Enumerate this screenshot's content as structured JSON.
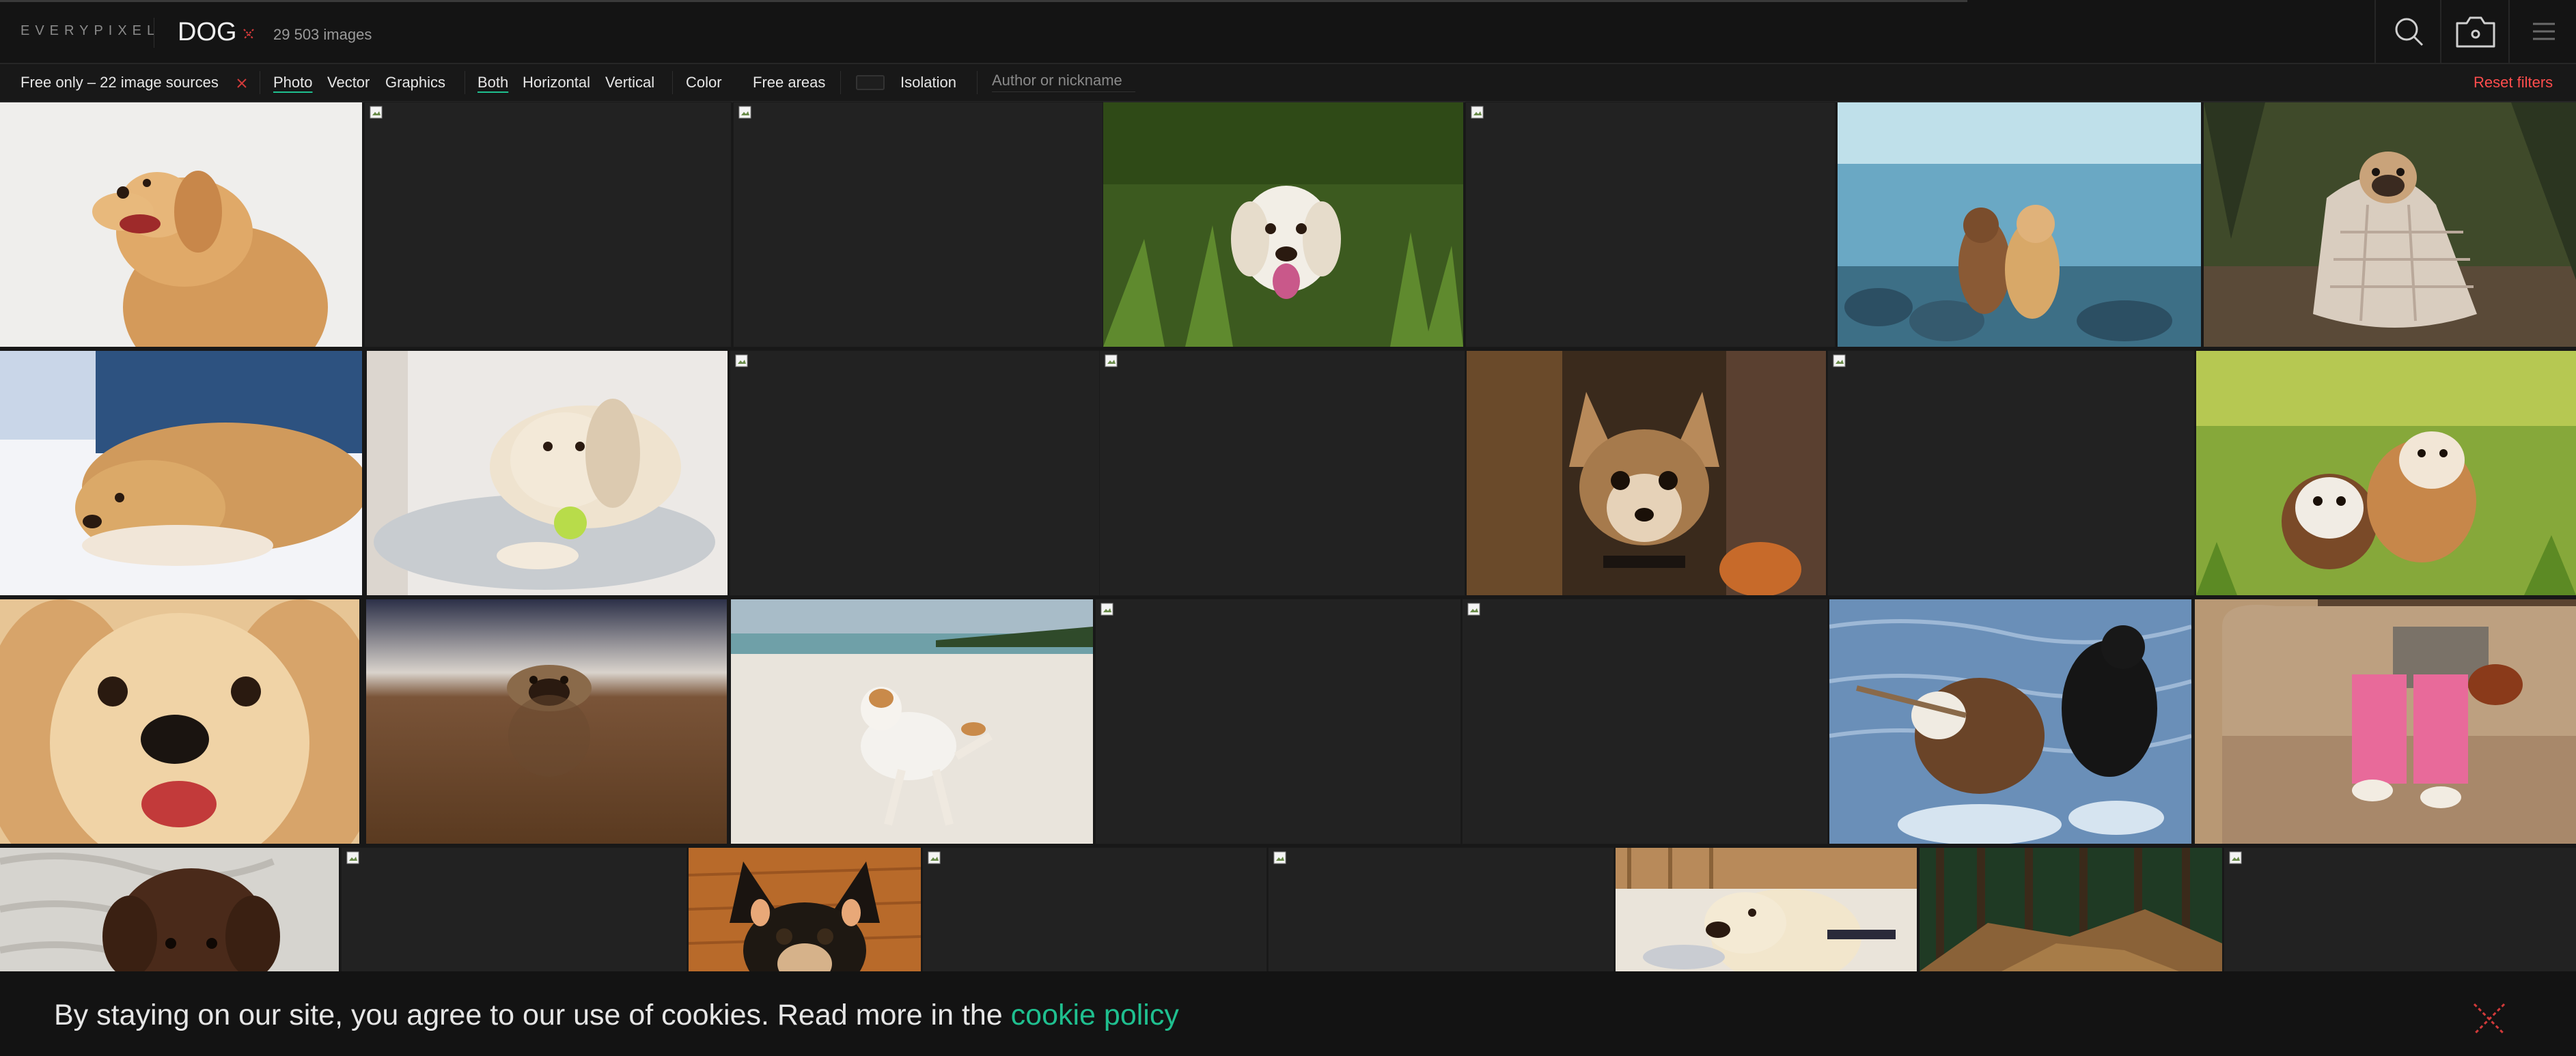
{
  "header": {
    "logo": "EVERYPIXEL",
    "query": "DOG",
    "count": "29 503 images"
  },
  "filters": {
    "free_only": "Free only – 22 image sources",
    "photo": "Photo",
    "vector": "Vector",
    "graphics": "Graphics",
    "both": "Both",
    "horizontal": "Horizontal",
    "vertical": "Vertical",
    "color": "Color",
    "free_areas": "Free areas",
    "isolation": "Isolation",
    "author_placeholder": "Author or nickname",
    "reset": "Reset filters"
  },
  "cookie": {
    "text": "By staying on our site, you agree to our use of cookies. Read more in the ",
    "link": "cookie policy"
  },
  "colors": {
    "accent": "#1fbf8f",
    "reset": "#ff4d4d",
    "background": "#181818"
  },
  "grid": {
    "images": [
      {
        "name": "golden-retriever-white-bg",
        "loaded": true
      },
      {
        "name": "broken-image",
        "loaded": false
      },
      {
        "name": "broken-image",
        "loaded": false
      },
      {
        "name": "golden-retriever-in-grass",
        "loaded": true
      },
      {
        "name": "broken-image",
        "loaded": false
      },
      {
        "name": "two-dogs-on-rocky-shore",
        "loaded": true
      },
      {
        "name": "pug-in-blanket",
        "loaded": true
      },
      {
        "name": "retriever-lying-on-floor",
        "loaded": true
      },
      {
        "name": "retriever-with-tennis-ball",
        "loaded": true
      },
      {
        "name": "broken-image",
        "loaded": false
      },
      {
        "name": "broken-image",
        "loaded": false
      },
      {
        "name": "chihuahua-portrait",
        "loaded": true
      },
      {
        "name": "broken-image",
        "loaded": false
      },
      {
        "name": "puppies-in-grass",
        "loaded": true
      },
      {
        "name": "retriever-closeup",
        "loaded": true
      },
      {
        "name": "pug-on-floor",
        "loaded": true
      },
      {
        "name": "jack-russell-on-beach",
        "loaded": true
      },
      {
        "name": "broken-image",
        "loaded": false
      },
      {
        "name": "broken-image",
        "loaded": false
      },
      {
        "name": "dogs-running-in-water",
        "loaded": true
      },
      {
        "name": "puppy-on-sofa",
        "loaded": true
      },
      {
        "name": "chocolate-lab-puppy",
        "loaded": true
      },
      {
        "name": "broken-image",
        "loaded": false
      },
      {
        "name": "chihuahua-on-wood",
        "loaded": true
      },
      {
        "name": "broken-image",
        "loaded": false
      },
      {
        "name": "broken-image",
        "loaded": false
      },
      {
        "name": "labrador-in-kitchen",
        "loaded": true
      },
      {
        "name": "forest-scene",
        "loaded": true
      },
      {
        "name": "broken-image",
        "loaded": false
      }
    ]
  }
}
